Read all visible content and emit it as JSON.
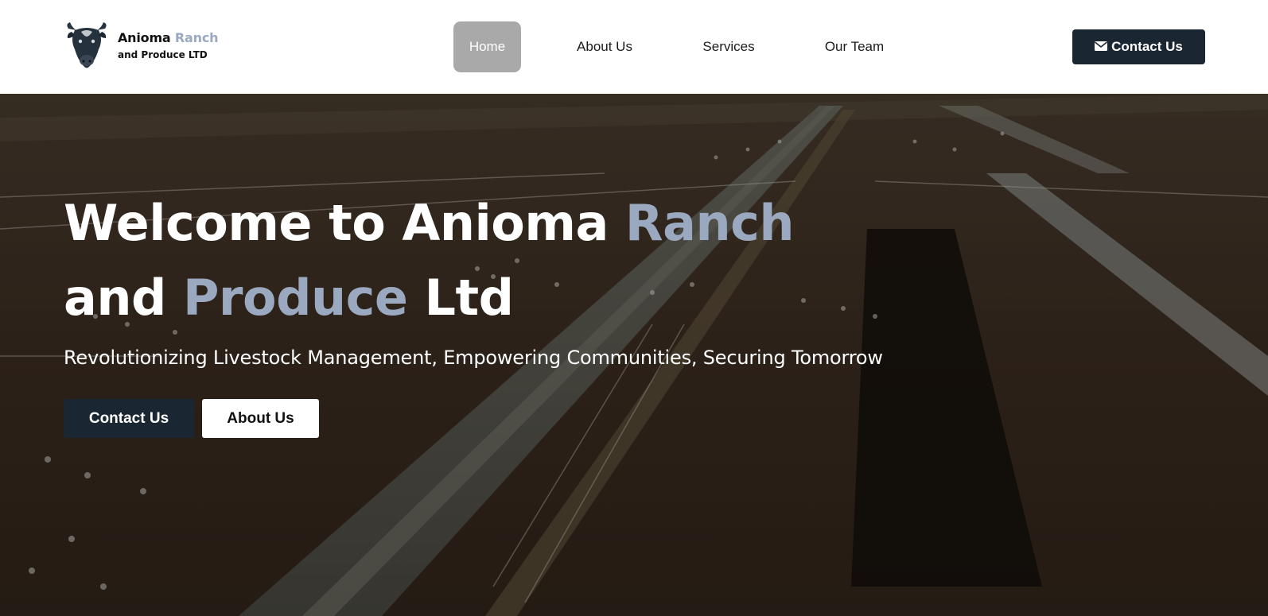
{
  "header": {
    "logo": {
      "name_part1": "Anioma",
      "name_accent": "Ranch",
      "name_line2": "and Produce LTD",
      "icon": "bull-head-icon"
    },
    "nav": [
      {
        "label": "Home",
        "active": true
      },
      {
        "label": "About Us",
        "active": false
      },
      {
        "label": "Services",
        "active": false
      },
      {
        "label": "Our Team",
        "active": false
      }
    ],
    "contact_button": {
      "label": "Contact Us",
      "icon": "envelope-icon"
    }
  },
  "hero": {
    "title_part1": "Welcome to Anioma",
    "title_accent1": "Ranch",
    "title_part2": "and",
    "title_accent2": "Produce",
    "title_part3": "Ltd",
    "subtitle": "Revolutionizing Livestock Management, Empowering Communities, Securing Tomorrow",
    "primary_button": "Contact Us",
    "secondary_button": "About Us",
    "background": "aerial-ranch-photo"
  },
  "colors": {
    "accent": "#9aa9bf",
    "dark": "#1a2733",
    "nav_active": "#a9a9a9"
  }
}
